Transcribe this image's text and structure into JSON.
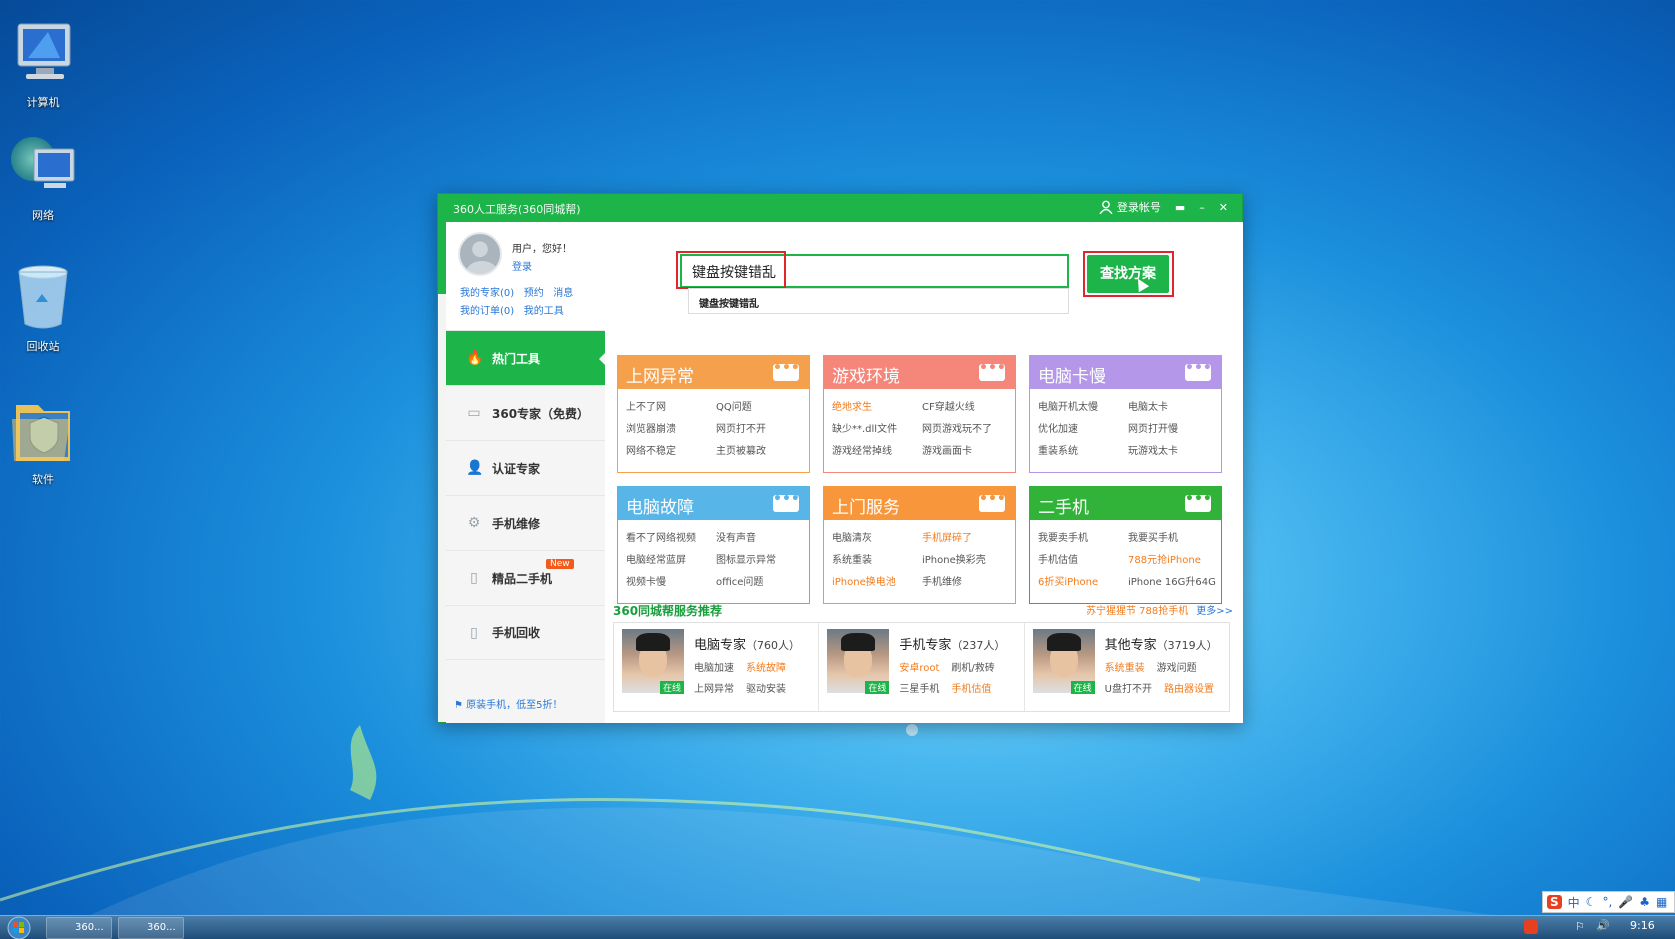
{
  "desktop": {
    "icons": [
      {
        "label": "计算机",
        "icon": "computer-icon"
      },
      {
        "label": "网络",
        "icon": "network-icon"
      },
      {
        "label": "回收站",
        "icon": "recycle-bin-icon"
      },
      {
        "label": "软件",
        "icon": "folder-icon"
      }
    ]
  },
  "window": {
    "title": "360人工服务(360同城帮)",
    "login_account": "登录帐号",
    "user": {
      "greeting": "用户，您好！",
      "login": "登录",
      "links_row1": [
        "我的专家(0)",
        "预约",
        "消息"
      ],
      "links_row2": [
        "我的订单(0)",
        "我的工具"
      ]
    },
    "nav": [
      "热门工具",
      "360专家（免费）",
      "认证专家",
      "手机维修",
      "精品二手机",
      "手机回收"
    ],
    "nav_badge": "New",
    "promo": "原装手机，低至5折！",
    "search": {
      "value": "键盘按键错乱",
      "suggestion": "键盘按键错乱",
      "button": "查找方案"
    },
    "cards": [
      {
        "title": "上网异常",
        "color": "#f5a04c",
        "border": "#f5a04c",
        "items": [
          [
            "上不了网",
            0
          ],
          [
            "QQ问题",
            0
          ],
          [
            "浏览器崩溃",
            0
          ],
          [
            "网页打不开",
            0
          ],
          [
            "网络不稳定",
            0
          ],
          [
            "主页被篡改",
            0
          ]
        ]
      },
      {
        "title": "游戏环境",
        "color": "#f5867a",
        "border": "#f5867a",
        "items": [
          [
            "绝地求生",
            1
          ],
          [
            "CF穿越火线",
            0
          ],
          [
            "缺少**.dll文件",
            0
          ],
          [
            "网页游戏玩不了",
            0
          ],
          [
            "游戏经常掉线",
            0
          ],
          [
            "游戏画面卡",
            0
          ]
        ]
      },
      {
        "title": "电脑卡慢",
        "color": "#b597e9",
        "border": "#b597e9",
        "items": [
          [
            "电脑开机太慢",
            0
          ],
          [
            "电脑太卡",
            0
          ],
          [
            "优化加速",
            0
          ],
          [
            "网页打开慢",
            0
          ],
          [
            "重装系统",
            0
          ],
          [
            "玩游戏太卡",
            0
          ]
        ]
      },
      {
        "title": "电脑故障",
        "color": "#58b5e8",
        "border": "#58b5e8",
        "items": [
          [
            "看不了网络视频",
            0
          ],
          [
            "没有声音",
            0
          ],
          [
            "电脑经常蓝屏",
            0
          ],
          [
            "图标显示异常",
            0
          ],
          [
            "视频卡慢",
            0
          ],
          [
            "office问题",
            0
          ]
        ]
      },
      {
        "title": "上门服务",
        "color": "#f7963a",
        "border": "#f7963a",
        "items": [
          [
            "电脑清灰",
            0
          ],
          [
            "手机屏碎了",
            1
          ],
          [
            "系统重装",
            0
          ],
          [
            "iPhone换彩壳",
            0
          ],
          [
            "iPhone换电池",
            1
          ],
          [
            "手机维修",
            0
          ]
        ]
      },
      {
        "title": "二手机",
        "color": "#31b33a",
        "border": "#31b33a",
        "items": [
          [
            "我要卖手机",
            0
          ],
          [
            "我要买手机",
            0
          ],
          [
            "手机估值",
            0
          ],
          [
            "788元抢iPhone",
            1
          ],
          [
            "6折买iPhone",
            1
          ],
          [
            "iPhone 16G升64G",
            0
          ]
        ]
      }
    ],
    "section_title": "360同城帮服务推荐",
    "section_promo": "苏宁猩猩节 788抢手机",
    "section_more": "更多>>",
    "experts": [
      {
        "name": "电脑专家",
        "count": "（760人）",
        "online": "在线",
        "tags1": [
          [
            "电脑加速",
            0
          ],
          [
            "系统故障",
            1
          ]
        ],
        "tags2": [
          [
            "上网异常",
            0
          ],
          [
            "驱动安装",
            0
          ]
        ]
      },
      {
        "name": "手机专家",
        "count": "（237人）",
        "online": "在线",
        "tags1": [
          [
            "安卓root",
            1
          ],
          [
            "刷机/救砖",
            0
          ]
        ],
        "tags2": [
          [
            "三星手机",
            0
          ],
          [
            "手机估值",
            1
          ]
        ]
      },
      {
        "name": "其他专家",
        "count": "（3719人）",
        "online": "在线",
        "tags1": [
          [
            "系统重装",
            1
          ],
          [
            "游戏问题",
            0
          ]
        ],
        "tags2": [
          [
            "U盘打不开",
            0
          ],
          [
            "路由器设置",
            1
          ]
        ]
      }
    ]
  },
  "taskbar": {
    "items": [
      "360...",
      "360..."
    ],
    "clock": "9:16",
    "ime": "中"
  },
  "colors": {
    "green": "#1db549",
    "orange": "#f37b1c",
    "link": "#2877d6",
    "red_highlight": "#e0262a"
  }
}
